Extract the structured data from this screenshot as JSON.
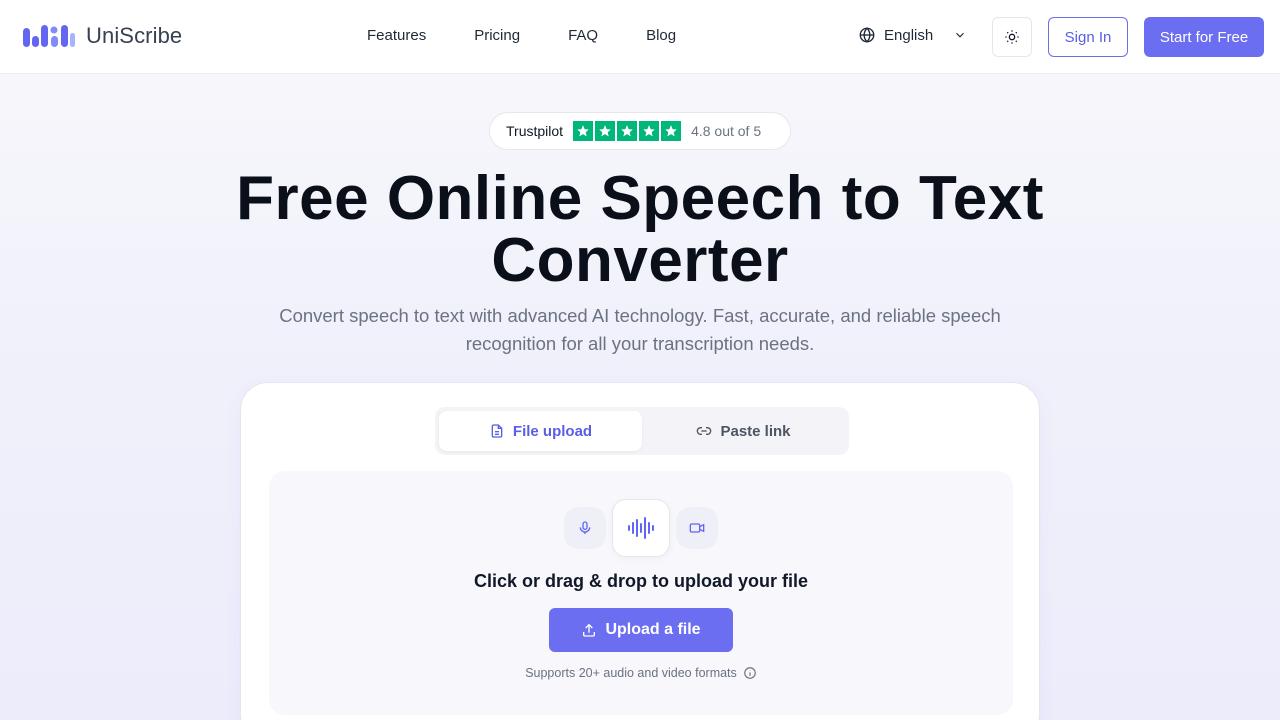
{
  "header": {
    "brand": "UniScribe",
    "nav": [
      "Features",
      "Pricing",
      "FAQ",
      "Blog"
    ],
    "language": "English",
    "signin_label": "Sign In",
    "start_label": "Start for Free"
  },
  "trust": {
    "name": "Trustpilot",
    "rating_text": "4.8 out of 5",
    "stars": 5,
    "star_color": "#00b67a"
  },
  "hero": {
    "title_line1": "Free Online Speech to Text",
    "title_line2": "Converter",
    "subtitle_line1": "Convert speech to text with advanced AI technology. Fast, accurate, and reliable speech",
    "subtitle_line2": "recognition for all your transcription needs."
  },
  "upload": {
    "tabs": [
      "File upload",
      "Paste link"
    ],
    "active_tab": "File upload",
    "dropzone_title": "Click or drag & drop to upload your file",
    "button_label": "Upload a file",
    "note": "Supports 20+ audio and video formats"
  },
  "colors": {
    "accent": "#6b6ef0",
    "accent_text": "#5b5de6"
  }
}
